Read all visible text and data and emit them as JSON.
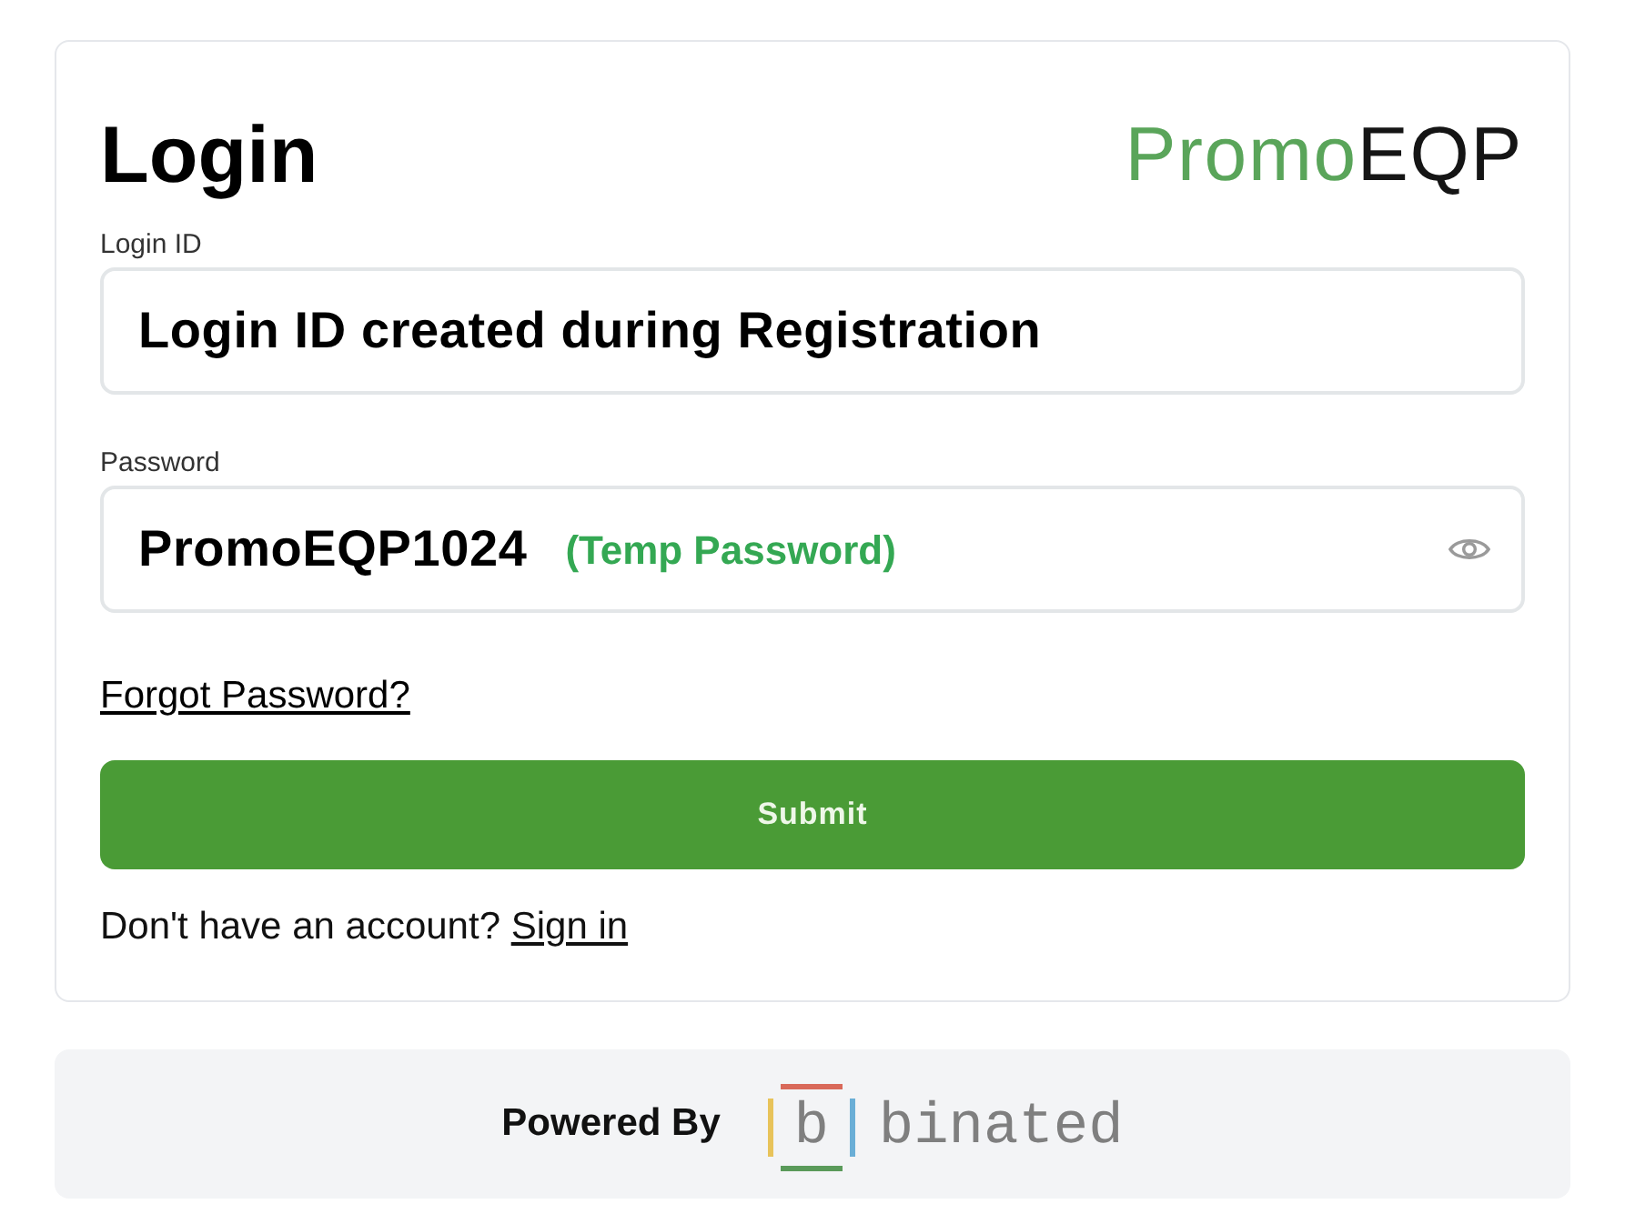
{
  "card": {
    "title": "Login",
    "logo": [
      {
        "text": "Promo",
        "color": "#5aa55a"
      },
      {
        "text": "EQP",
        "color": "#151515"
      }
    ]
  },
  "fields": [
    {
      "kind": "text",
      "label": "Login ID",
      "value": "Login ID created during Registration"
    },
    {
      "kind": "password",
      "label": "Password",
      "value": "PromoEQP1024",
      "note": "(Temp Password)"
    }
  ],
  "forgot_link": "Forgot Password?",
  "submit": "Submit",
  "signup": {
    "prompt": "Don't have an account?",
    "link": "Sign in"
  },
  "footer": {
    "label": "Powered By",
    "logo_mark": "b",
    "logo_name": "binated"
  }
}
